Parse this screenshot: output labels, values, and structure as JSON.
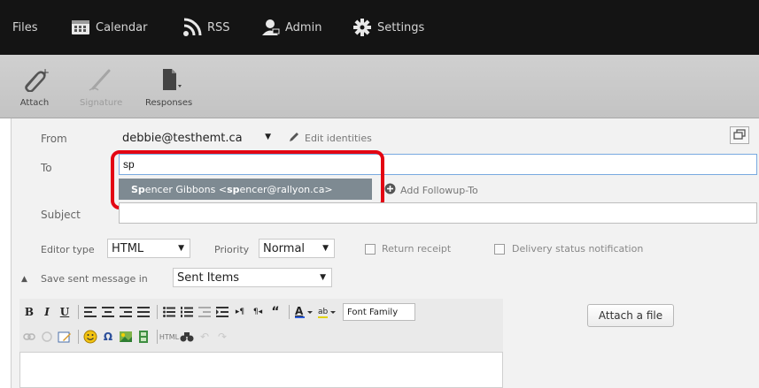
{
  "nav": {
    "files": "Files",
    "calendar": "Calendar",
    "rss": "RSS",
    "admin": "Admin",
    "settings": "Settings"
  },
  "toolbar": {
    "attach": "Attach",
    "signature": "Signature",
    "responses": "Responses"
  },
  "compose": {
    "from_label": "From",
    "from_value": "debbie@testhemt.ca",
    "edit_identities": "Edit identities",
    "to_label": "To",
    "to_value": "sp",
    "add_followup": "Add Followup-To",
    "subject_label": "Subject",
    "subject_value": "",
    "autocomplete": {
      "match1": "Sp",
      "part1": "encer Gibbons <",
      "match2": "sp",
      "part2": "encer@rallyon.ca>"
    },
    "editor_type_label": "Editor type",
    "editor_type_value": "HTML",
    "priority_label": "Priority",
    "priority_value": "Normal",
    "return_receipt": "Return receipt",
    "delivery_status": "Delivery status notification",
    "save_sent_label": "Save sent message in",
    "save_sent_value": "Sent Items"
  },
  "editor": {
    "bold": "B",
    "italic": "I",
    "underline": "U",
    "font_family": "Font Family",
    "omega": "Ω"
  },
  "attach_file": "Attach a file",
  "colors": {
    "topbar": "#141414",
    "highlight": "#e30613",
    "autocomplete_bg": "#7e8a92"
  }
}
